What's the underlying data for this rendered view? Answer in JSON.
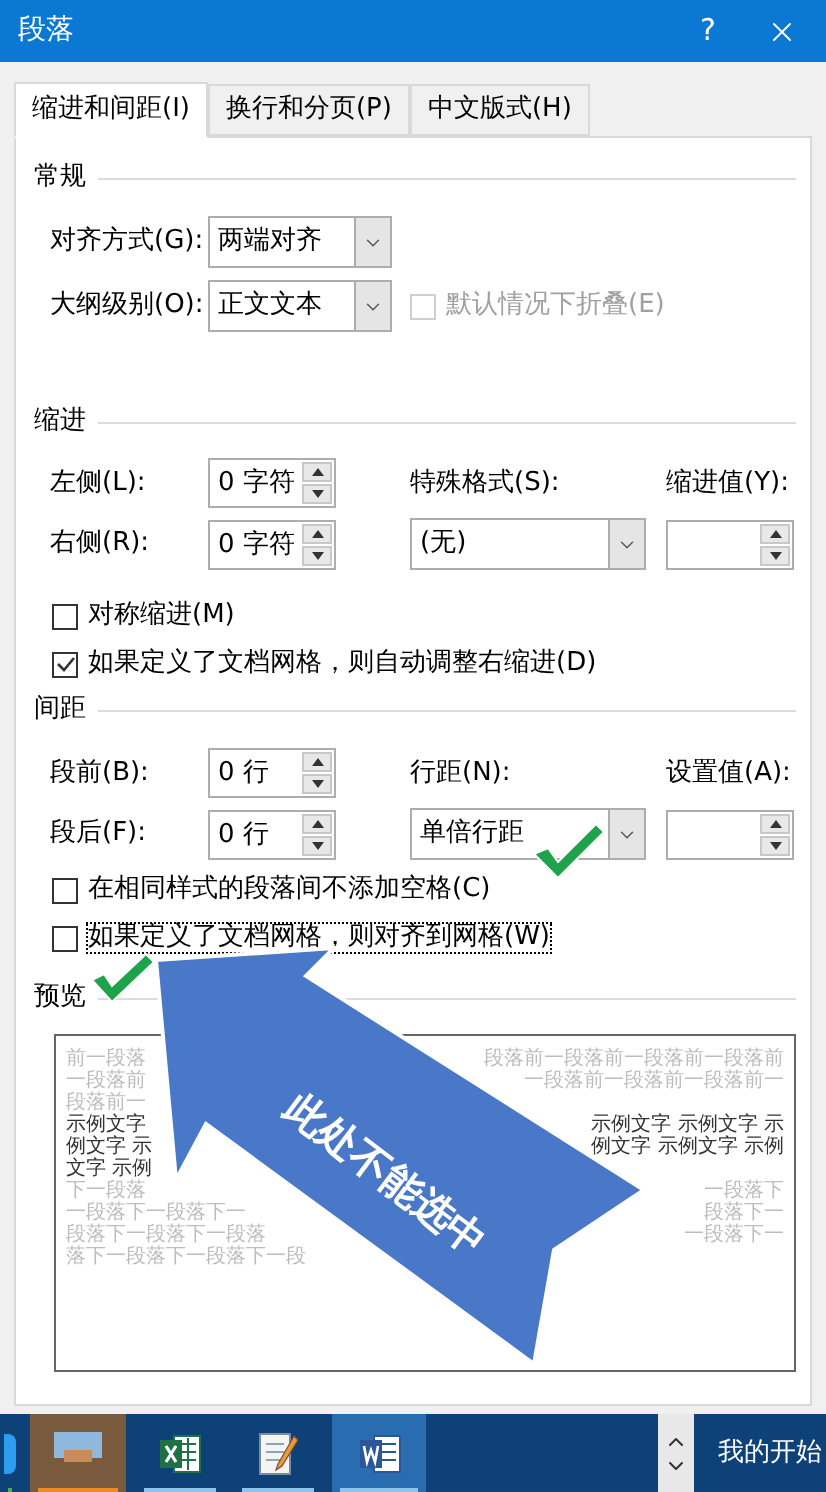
{
  "window": {
    "title": "段落",
    "help": "?"
  },
  "tabs": [
    {
      "label": "缩进和间距(I)",
      "selected": true
    },
    {
      "label": "换行和分页(P)",
      "selected": false
    },
    {
      "label": "中文版式(H)",
      "selected": false
    }
  ],
  "general": {
    "heading": "常规",
    "alignment": {
      "label": "对齐方式(G):",
      "value": "两端对齐"
    },
    "outline_level": {
      "label": "大纲级别(O):",
      "value": "正文文本"
    },
    "collapse": {
      "label": "默认情况下折叠(E)",
      "checked": false,
      "disabled": true
    }
  },
  "indent": {
    "heading": "缩进",
    "left": {
      "label": "左侧(L):",
      "value": "0 字符"
    },
    "right": {
      "label": "右侧(R):",
      "value": "0 字符"
    },
    "special": {
      "label": "特殊格式(S):",
      "value": "(无)"
    },
    "by": {
      "label": "缩进值(Y):"
    },
    "options": [
      {
        "label": "对称缩进(M)",
        "checked": false,
        "focused": false
      },
      {
        "label": "如果定义了文档网格，则自动调整右缩进(D)",
        "checked": true,
        "focused": false
      }
    ]
  },
  "spacing": {
    "heading": "间距",
    "before": {
      "label": "段前(B):",
      "value": "0 行"
    },
    "after": {
      "label": "段后(F):",
      "value": "0 行"
    },
    "line_spacing": {
      "label": "行距(N):",
      "value": "单倍行距"
    },
    "at": {
      "label": "设置值(A):"
    },
    "options": [
      {
        "label": "在相同样式的段落间不添加空格(C)",
        "checked": false,
        "focused": false
      },
      {
        "label": "如果定义了文档网格，则对齐到网格(W)",
        "checked": false,
        "focused": true
      }
    ]
  },
  "preview": {
    "heading": "预览",
    "lines": [
      {
        "kind": "context",
        "left": "前一段落",
        "right": "段落前一段落前一段落前一段落前"
      },
      {
        "kind": "context",
        "left": "一段落前",
        "right": "一段落前一段落前一段落前一"
      },
      {
        "kind": "context",
        "left": "段落前一"
      },
      {
        "kind": "sample",
        "left": "示例文字",
        "right": "示例文字 示例文字 示"
      },
      {
        "kind": "sample",
        "left": "例文字 示",
        "right": "例文字 示例文字 示例"
      },
      {
        "kind": "sample",
        "left": "文字 示例"
      },
      {
        "kind": "context",
        "left": "下一段落",
        "right": "一段落下"
      },
      {
        "kind": "context",
        "left": "一段落下一段落下一",
        "right": "段落下一"
      },
      {
        "kind": "context",
        "left": "段落下一段落下一段落",
        "right": "一段落下一"
      },
      {
        "kind": "context",
        "left": "落下一段落下一段落下一段"
      }
    ]
  },
  "annotation": {
    "text": "此处不能选中"
  },
  "taskbar": {
    "apps": [
      {
        "kind": "blue_app",
        "active": false
      },
      {
        "kind": "photos",
        "active": false
      },
      {
        "kind": "excel",
        "active": false
      },
      {
        "kind": "notepad",
        "active": false
      },
      {
        "kind": "word",
        "active": true
      }
    ],
    "label": "我的开始"
  }
}
